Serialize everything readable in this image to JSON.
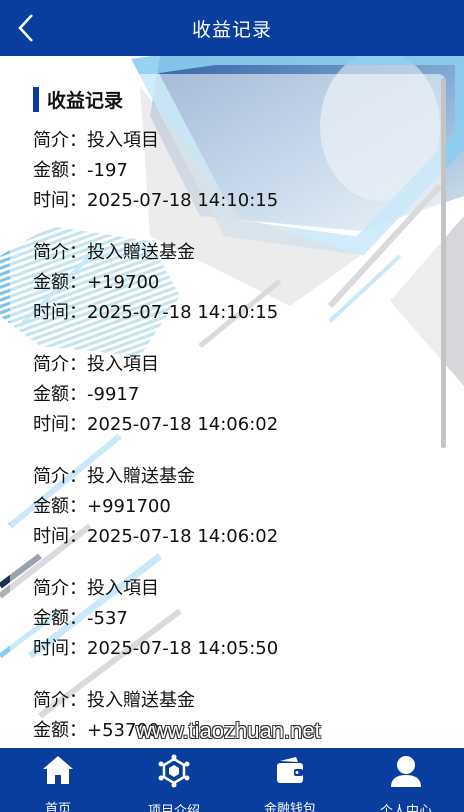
{
  "header": {
    "title": "收益记录",
    "back_icon": "chevron-left-icon"
  },
  "section": {
    "title": "收益记录"
  },
  "labels": {
    "intro": "简介：",
    "amount": "金额：",
    "time": "时间："
  },
  "records": [
    {
      "intro": "投入項目",
      "amount": "-197",
      "time": "2025-07-18 14:10:15"
    },
    {
      "intro": "投入贈送基金",
      "amount": "+19700",
      "time": "2025-07-18 14:10:15"
    },
    {
      "intro": "投入項目",
      "amount": "-9917",
      "time": "2025-07-18 14:06:02"
    },
    {
      "intro": "投入贈送基金",
      "amount": "+991700",
      "time": "2025-07-18 14:06:02"
    },
    {
      "intro": "投入項目",
      "amount": "-537",
      "time": "2025-07-18 14:05:50"
    },
    {
      "intro": "投入贈送基金",
      "amount": "+53700",
      "time": ""
    }
  ],
  "watermark": "www.tiaozhuan.net",
  "tabbar": [
    {
      "label": "首页",
      "icon": "home-icon"
    },
    {
      "label": "项目介绍",
      "icon": "cube-network-icon"
    },
    {
      "label": "金融钱包",
      "icon": "wallet-icon"
    },
    {
      "label": "个人中心",
      "icon": "user-icon"
    }
  ],
  "colors": {
    "primary": "#0a3e9e",
    "accent_light_blue": "#8ccdf0",
    "decor_gray": "#b8b8be"
  }
}
